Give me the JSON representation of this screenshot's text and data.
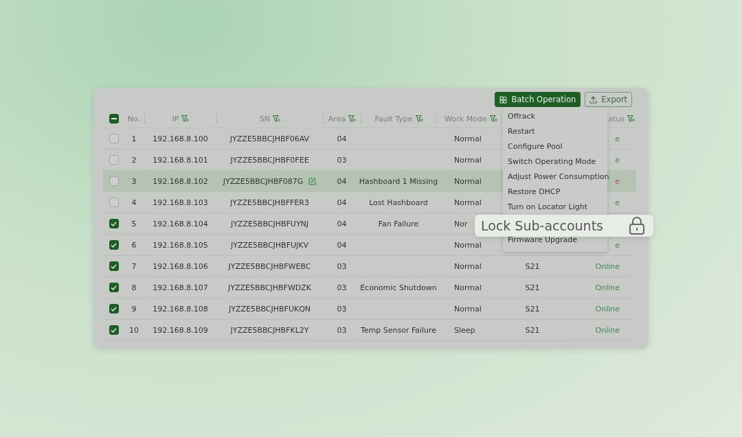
{
  "toolbar": {
    "buttons": [
      {
        "label": "Batch Operation",
        "kind": "primary"
      },
      {
        "label": "Export",
        "kind": "outline"
      }
    ]
  },
  "table": {
    "select_all": {
      "checked": true,
      "partial": true
    },
    "columns": [
      {
        "label": "No.",
        "filter": false
      },
      {
        "label": "IP",
        "filter": true
      },
      {
        "label": "SN",
        "filter": true
      },
      {
        "label": "Area",
        "filter": true
      },
      {
        "label": "Fault Type",
        "filter": true
      },
      {
        "label": "Work Mode",
        "filter": true
      },
      {
        "label": "atus",
        "filter": true
      }
    ],
    "rows": [
      {
        "checked": false,
        "selected": false,
        "no": "1",
        "ip": "192.168.8.100",
        "sn": "JYZZE5BBCJHBF06AV",
        "edit": false,
        "area": "04",
        "fault": "",
        "mode": "Normal",
        "model": "",
        "status": "e",
        "online": true
      },
      {
        "checked": false,
        "selected": false,
        "no": "2",
        "ip": "192.168.8.101",
        "sn": "JYZZE5BBCJHBF0FEE",
        "edit": false,
        "area": "03",
        "fault": "",
        "mode": "Normal",
        "model": "",
        "status": "e",
        "online": true
      },
      {
        "checked": false,
        "selected": true,
        "no": "3",
        "ip": "192.168.8.102",
        "sn": "JYZZE5BBCJHBF087G",
        "edit": true,
        "area": "04",
        "fault": "Hashboard 1 Missing",
        "mode": "Normal",
        "model": "",
        "status": "e",
        "online": false
      },
      {
        "checked": false,
        "selected": false,
        "no": "4",
        "ip": "192.168.8.103",
        "sn": "JYZZE5BBCJHBFFER3",
        "edit": false,
        "area": "04",
        "fault": "Lost Hashboard",
        "mode": "Normal",
        "model": "",
        "status": "e",
        "online": true
      },
      {
        "checked": true,
        "selected": false,
        "no": "5",
        "ip": "192.168.8.104",
        "sn": "JYZZE5BBCJHBFUYNJ",
        "edit": false,
        "area": "04",
        "fault": "Fan Failure",
        "mode": "Nor",
        "model": ""
      },
      {
        "checked": true,
        "selected": false,
        "no": "6",
        "ip": "192.168.8.105",
        "sn": "JYZZE5BBCJHBFUJKV",
        "edit": false,
        "area": "04",
        "fault": "",
        "mode": "Normal",
        "model": "",
        "status": "e",
        "online": true
      },
      {
        "checked": true,
        "selected": false,
        "no": "7",
        "ip": "192.168.8.106",
        "sn": "JYZZE5BBCJHBFWEBC",
        "edit": false,
        "area": "03",
        "fault": "",
        "mode": "Normal",
        "model": "S21",
        "status": "Online",
        "online": true
      },
      {
        "checked": true,
        "selected": false,
        "no": "8",
        "ip": "192.168.8.107",
        "sn": "JYZZE5BBCJHBFWDZK",
        "edit": false,
        "area": "03",
        "fault": "Economic Shutdown",
        "mode": "Normal",
        "model": "S21",
        "status": "Online",
        "online": true
      },
      {
        "checked": true,
        "selected": false,
        "no": "9",
        "ip": "192.168.8.108",
        "sn": "JYZZE5BBCJHBFUKQN",
        "edit": false,
        "area": "03",
        "fault": "",
        "mode": "Normal",
        "model": "S21",
        "status": "Online",
        "online": true
      },
      {
        "checked": true,
        "selected": false,
        "no": "10",
        "ip": "192.168.8.109",
        "sn": "JYZZE5BBCJHBFKL2Y",
        "edit": false,
        "area": "03",
        "fault": "Temp Sensor Failure",
        "mode": "Sleep",
        "model": "S21",
        "status": "Online",
        "online": true
      }
    ]
  },
  "batch_menu": {
    "items": [
      "Offrack",
      "Restart",
      "Configure Pool",
      "Switch Operating Mode",
      "Adjust Power Consumption",
      "Restore DHCP",
      "Turn on Locator Light",
      "Firmware Upgrade"
    ]
  },
  "highlight": {
    "label": "Lock Sub-accounts"
  }
}
